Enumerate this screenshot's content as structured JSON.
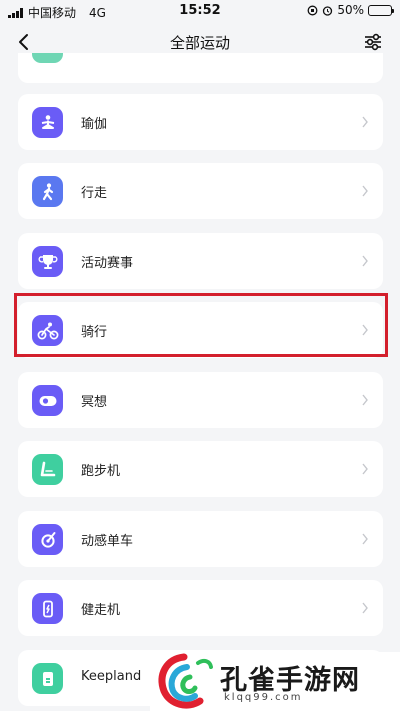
{
  "status_bar": {
    "carrier": "中国移动",
    "network": "4G",
    "time": "15:52",
    "battery_text": "50%",
    "battery_level": 0.5
  },
  "header": {
    "title": "全部运动"
  },
  "list": {
    "items": [
      {
        "label": "瑜伽",
        "icon": "yoga-icon",
        "color": "#6a5cf6"
      },
      {
        "label": "行走",
        "icon": "walking-icon",
        "color": "#5a78f0"
      },
      {
        "label": "活动赛事",
        "icon": "trophy-icon",
        "color": "#6a5cf6"
      },
      {
        "label": "骑行",
        "icon": "cycling-icon",
        "color": "#6a5cf6"
      },
      {
        "label": "冥想",
        "icon": "meditation-icon",
        "color": "#6a5cf6"
      },
      {
        "label": "跑步机",
        "icon": "treadmill-icon",
        "color": "#3fcf9f"
      },
      {
        "label": "动感单车",
        "icon": "spin-bike-icon",
        "color": "#6a5cf6"
      },
      {
        "label": "健走机",
        "icon": "walking-machine-icon",
        "color": "#6a5cf6"
      },
      {
        "label": "Keepland",
        "icon": "keepland-icon",
        "color": "#3fcf9f"
      }
    ]
  },
  "highlight_color": "#d31f2c",
  "watermark": {
    "brand_text": "孔雀手游网",
    "url_text": "klqq99.com"
  }
}
